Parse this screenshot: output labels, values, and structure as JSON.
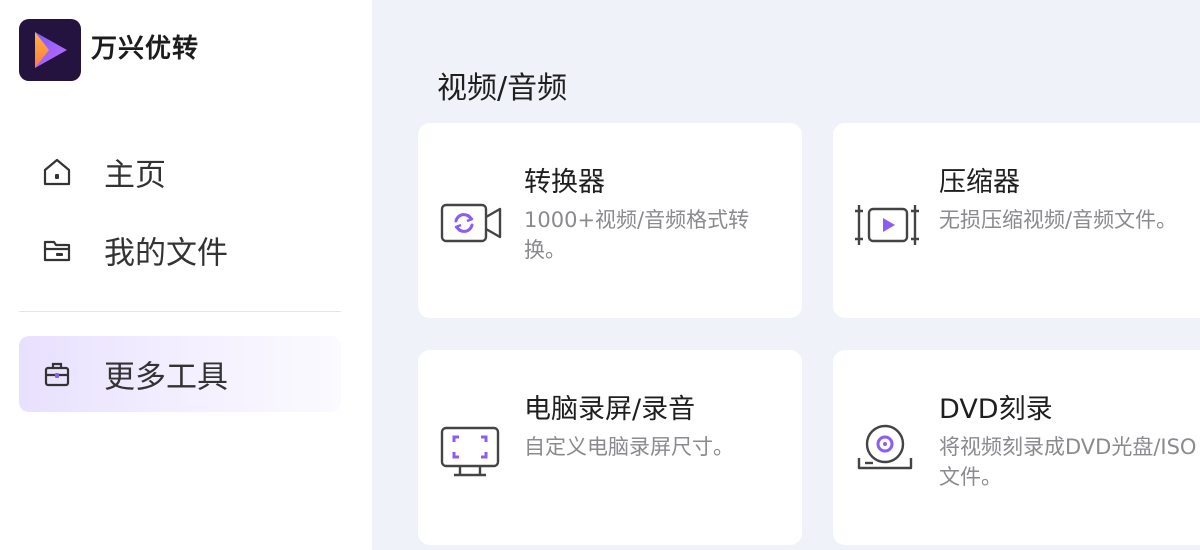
{
  "app": {
    "name": "万兴优转"
  },
  "sidebar": {
    "items": [
      {
        "label": "主页",
        "icon": "home-icon"
      },
      {
        "label": "我的文件",
        "icon": "folder-icon"
      },
      {
        "label": "更多工具",
        "icon": "toolbox-icon",
        "active": true
      }
    ]
  },
  "main": {
    "section_title": "视频/音频",
    "cards": [
      {
        "title": "转换器",
        "desc": "1000+视频/音频格式转换。",
        "icon": "converter-icon"
      },
      {
        "title": "压缩器",
        "desc": "无损压缩视频/音频文件。",
        "icon": "compressor-icon"
      },
      {
        "title": "电脑录屏/录音",
        "desc": "自定义电脑录屏尺寸。",
        "icon": "screen-recorder-icon"
      },
      {
        "title": "DVD刻录",
        "desc": "将视频刻录成DVD光盘/ISO文件。",
        "icon": "dvd-burner-icon"
      }
    ]
  },
  "colors": {
    "accent": "#8b5cf6",
    "sidebar_active_bg": "#ece6ff",
    "main_bg": "#f0f2f9",
    "icon_dark": "#444444"
  }
}
